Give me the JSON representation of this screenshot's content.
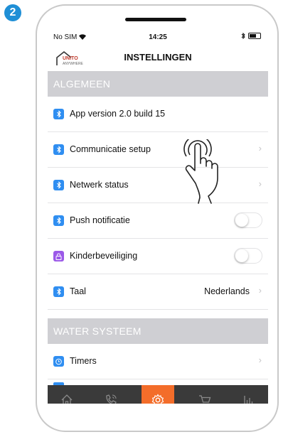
{
  "step": {
    "number": "2"
  },
  "status_bar": {
    "carrier": "No SIM",
    "time": "14:25"
  },
  "nav": {
    "logo_text": "UNITO",
    "logo_subtext": "ANYWHERE",
    "title": "INSTELLINGEN"
  },
  "sections": [
    {
      "header": "ALGEMEEN",
      "rows": [
        {
          "icon": "bluetooth-icon",
          "label": "App version 2.0 build 15"
        },
        {
          "icon": "bluetooth-icon",
          "label": "Communicatie setup"
        },
        {
          "icon": "bluetooth-icon",
          "label": "Netwerk status"
        },
        {
          "icon": "bluetooth-icon",
          "label": "Push notificatie",
          "toggle": false
        },
        {
          "icon": "lock-icon",
          "label": "Kinderbeveiliging",
          "toggle": false
        },
        {
          "icon": "bluetooth-icon",
          "label": "Taal",
          "value": "Nederlands"
        }
      ]
    },
    {
      "header": "WATER SYSTEEM",
      "rows": [
        {
          "icon": "alarm-clock-icon",
          "label": "Timers"
        }
      ]
    }
  ],
  "tabbar": {
    "items": [
      "home-icon",
      "phone-icon",
      "settings-gear-icon",
      "cart-icon",
      "bar-chart-icon"
    ],
    "active": "settings-gear-icon"
  },
  "colors": {
    "accent": "#f36d2a",
    "icon_blue": "#2f8ef1",
    "icon_purple": "#9b59e8",
    "step_badge": "#1f8fd6",
    "section_bg": "#cfcfd3",
    "tabbar_bg": "#3a3a3a"
  }
}
